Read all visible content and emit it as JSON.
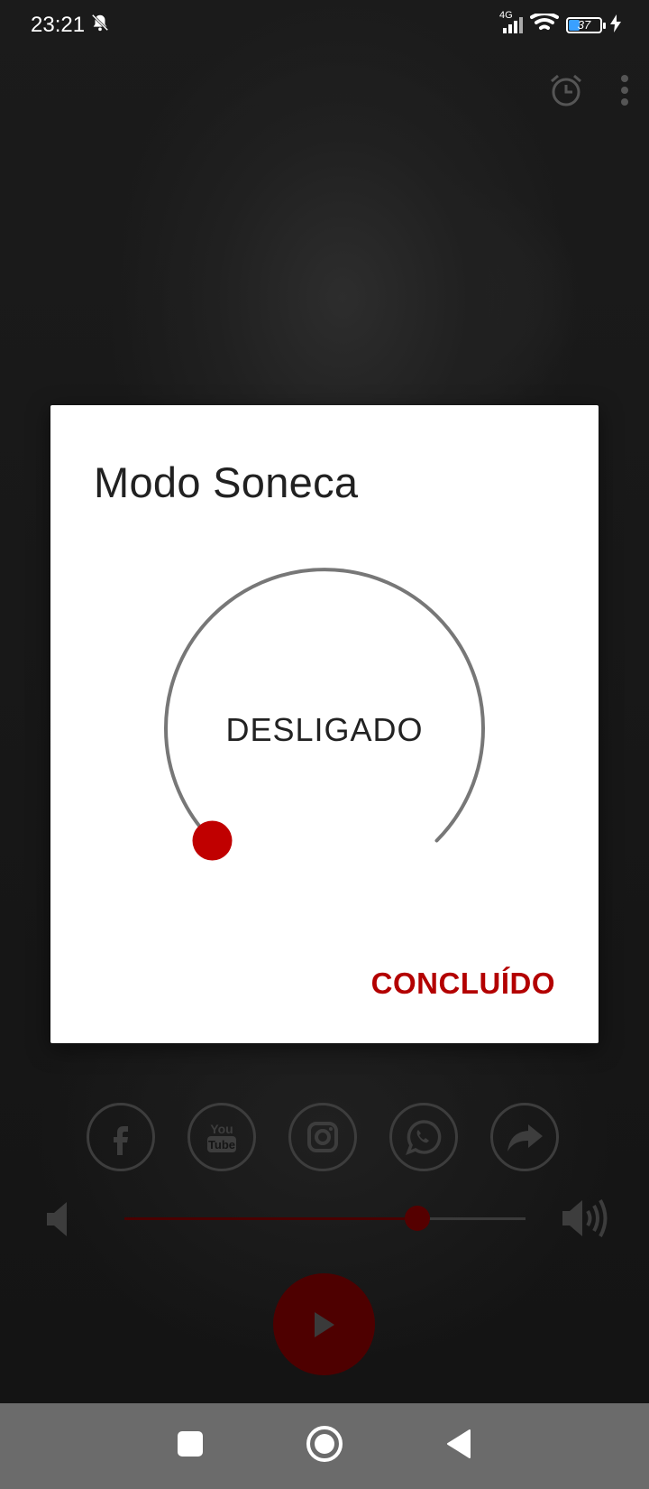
{
  "status_bar": {
    "time": "23:21",
    "network": "4G",
    "battery": "37"
  },
  "dialog": {
    "title": "Modo Soneca",
    "dial_value_label": "DESLIGADO",
    "dial_level": 0,
    "done_label": "CONCLUÍDO"
  },
  "social": {
    "items": [
      "facebook-icon",
      "youtube-icon",
      "instagram-icon",
      "whatsapp-icon",
      "share-icon"
    ]
  },
  "volume": {
    "level": 0.73
  },
  "colors": {
    "accent": "#b30000",
    "dial_knob": "#c00000",
    "dial_track": "#777777"
  }
}
